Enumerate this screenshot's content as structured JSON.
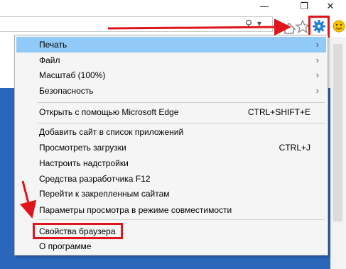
{
  "window": {
    "minimize_icon": "minimize-icon",
    "restore_icon": "restore-icon",
    "close_icon": "close-icon"
  },
  "toolbar": {
    "search_icon": "magnifier-icon",
    "home_icon": "home-icon",
    "favorites_icon": "star-icon",
    "tools_icon": "gear-icon",
    "feedback_icon": "smiley-icon"
  },
  "menu": {
    "items": [
      {
        "label": "Печать",
        "submenu": true
      },
      {
        "label": "Файл",
        "submenu": true
      },
      {
        "label": "Масштаб (100%)",
        "submenu": true
      },
      {
        "label": "Безопасность",
        "submenu": true
      },
      {
        "label": "Открыть с помощью Microsoft Edge",
        "shortcut": "CTRL+SHIFT+E"
      },
      {
        "label": "Добавить сайт в список приложений"
      },
      {
        "label": "Просмотреть загрузки",
        "shortcut": "CTRL+J"
      },
      {
        "label": "Настроить надстройки"
      },
      {
        "label": "Средства разработчика F12"
      },
      {
        "label": "Перейти к закрепленным сайтам"
      },
      {
        "label": "Параметры просмотра в режиме совместимости"
      },
      {
        "label": "Свойства браузера"
      },
      {
        "label": "О программе"
      }
    ],
    "highlighted_index": 0,
    "annotated_index": 11
  },
  "colors": {
    "menu_highlight": "#91c9f7",
    "annotation_red": "#e0141b",
    "gear_blue": "#1f7fd1",
    "page_blue": "#2a66ba"
  }
}
